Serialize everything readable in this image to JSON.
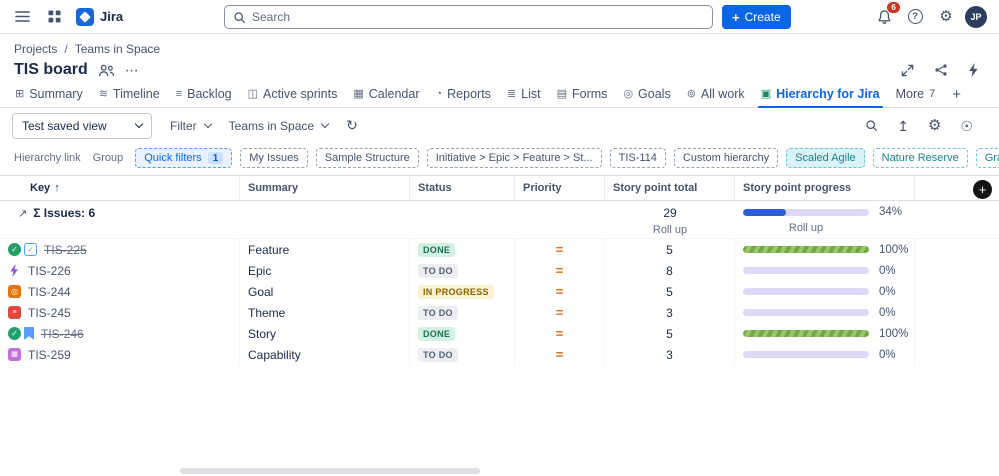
{
  "colors": {
    "accent_blue": "#0C66E4",
    "notification_red": "#CA3521",
    "active_tab_blue": "#0C66E4",
    "progress_fill_blue": "#2B5CD9",
    "progress_fill_green": "#74A843",
    "progress_track_lavender": "#DFD9F8",
    "priority_medium_orange": "#E56910",
    "status_done_text": "#216E4E",
    "status_inprogress_bg": "#FAF0D2",
    "teal_chip_text": "#1D7F8C"
  },
  "topbar": {
    "app_name": "Jira",
    "search_placeholder": "Search",
    "create_label": "Create",
    "notification_count": "6",
    "avatar_initials": "JP"
  },
  "breadcrumb": {
    "items": [
      "Projects",
      "Teams in Space"
    ]
  },
  "header": {
    "title": "TIS board"
  },
  "tabs": {
    "items": [
      {
        "id": "summary",
        "label": "Summary"
      },
      {
        "id": "timeline",
        "label": "Timeline"
      },
      {
        "id": "backlog",
        "label": "Backlog"
      },
      {
        "id": "active-sprints",
        "label": "Active sprints"
      },
      {
        "id": "calendar",
        "label": "Calendar"
      },
      {
        "id": "reports",
        "label": "Reports"
      },
      {
        "id": "list",
        "label": "List"
      },
      {
        "id": "forms",
        "label": "Forms"
      },
      {
        "id": "goals",
        "label": "Goals"
      },
      {
        "id": "all-work",
        "label": "All work"
      },
      {
        "id": "hierarchy",
        "label": "Hierarchy for Jira",
        "active": true
      },
      {
        "id": "more",
        "label": "More",
        "count": "7"
      }
    ]
  },
  "toolbar": {
    "saved_view": "Test saved view",
    "filter_label": "Filter",
    "scope_label": "Teams in Space"
  },
  "filter_bar": {
    "hierarchy_link_label": "Hierarchy link",
    "group_label": "Group",
    "chips": [
      {
        "label": "Quick filters",
        "badge": "1",
        "style": "blue"
      },
      {
        "label": "My Issues",
        "style": "gray"
      },
      {
        "label": "Sample Structure",
        "style": "gray"
      },
      {
        "label": "Initiative > Epic > Feature > St...",
        "style": "gray"
      },
      {
        "label": "TIS-114",
        "style": "gray"
      },
      {
        "label": "Custom hierarchy",
        "style": "gray"
      },
      {
        "label": "Scaled Agile",
        "style": "teal-filled"
      },
      {
        "label": "Nature Reserve",
        "style": "teal"
      },
      {
        "label": "Gravity",
        "style": "teal"
      }
    ]
  },
  "table": {
    "columns": [
      "Key",
      "Summary",
      "Status",
      "Priority",
      "Story point total",
      "Story point progress"
    ],
    "sort_column": "Key",
    "sort_direction": "ascending",
    "summary_row": {
      "label": "Σ Issues: 6",
      "story_point_total": "29",
      "total_note": "Roll up",
      "progress_percent": 34,
      "progress_label": "34%",
      "progress_note": "Roll up"
    },
    "rows": [
      {
        "key": "TIS-225",
        "resolved": true,
        "icons": [
          "status-done",
          "feature"
        ],
        "summary": "Feature",
        "status": "DONE",
        "status_style": "done",
        "priority": "medium",
        "story_point_total": "5",
        "progress_percent": 100,
        "progress_label": "100%"
      },
      {
        "key": "TIS-226",
        "resolved": false,
        "icons": [
          "epic"
        ],
        "summary": "Epic",
        "status": "TO DO",
        "status_style": "todo",
        "priority": "medium",
        "story_point_total": "8",
        "progress_percent": 0,
        "progress_label": "0%"
      },
      {
        "key": "TIS-244",
        "resolved": false,
        "icons": [
          "goal"
        ],
        "summary": "Goal",
        "status": "IN PROGRESS",
        "status_style": "inprogress",
        "priority": "medium",
        "story_point_total": "5",
        "progress_percent": 0,
        "progress_label": "0%"
      },
      {
        "key": "TIS-245",
        "resolved": false,
        "icons": [
          "theme"
        ],
        "summary": "Theme",
        "status": "TO DO",
        "status_style": "todo",
        "priority": "medium",
        "story_point_total": "3",
        "progress_percent": 0,
        "progress_label": "0%"
      },
      {
        "key": "TIS-246",
        "resolved": true,
        "icons": [
          "status-done",
          "story"
        ],
        "summary": "Story",
        "status": "DONE",
        "status_style": "done",
        "priority": "medium",
        "story_point_total": "5",
        "progress_percent": 100,
        "progress_label": "100%"
      },
      {
        "key": "TIS-259",
        "resolved": false,
        "icons": [
          "capability"
        ],
        "summary": "Capability",
        "status": "TO DO",
        "status_style": "todo",
        "priority": "medium",
        "story_point_total": "3",
        "progress_percent": 0,
        "progress_label": "0%"
      }
    ]
  }
}
